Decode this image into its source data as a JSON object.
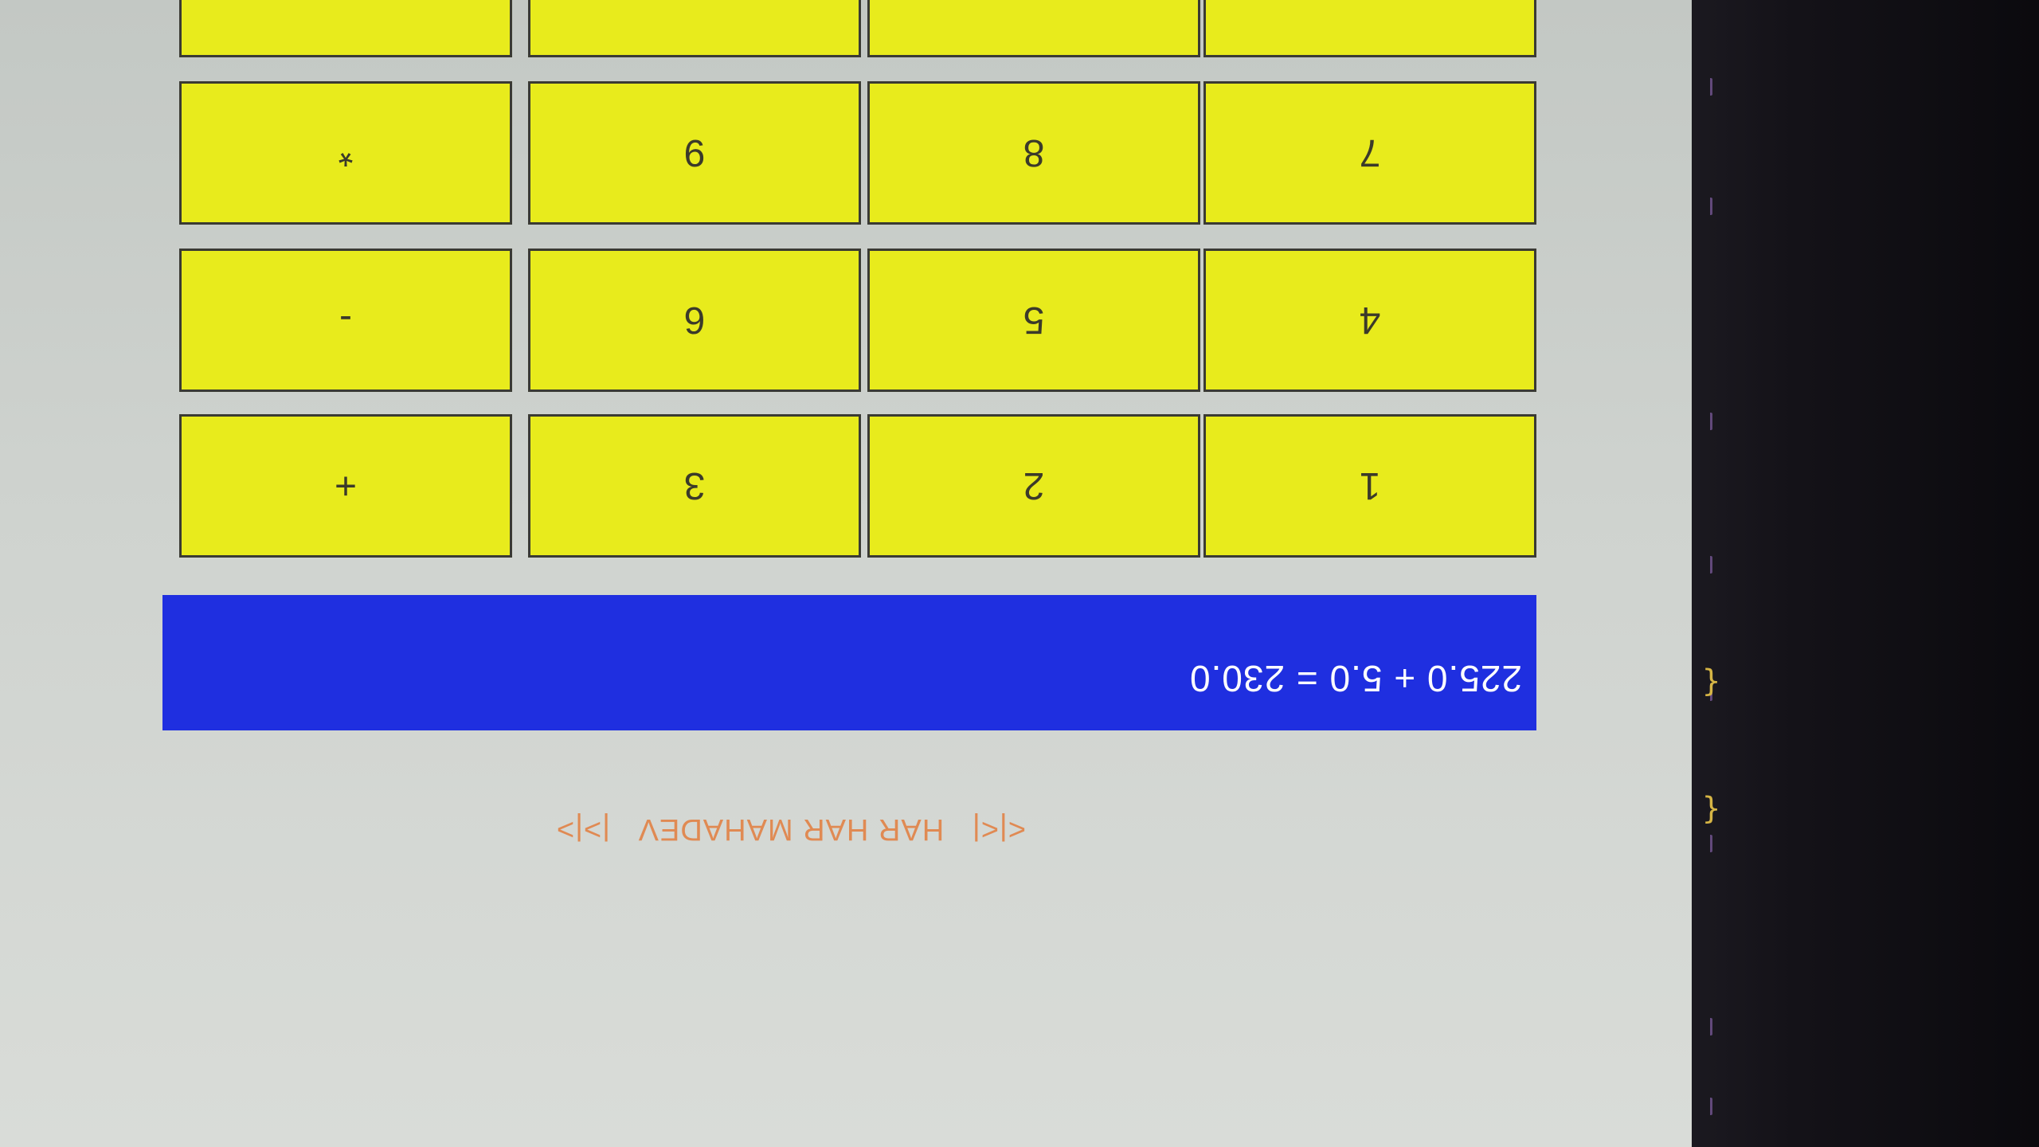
{
  "window": {
    "title": "<|<|   HAR HAR MAHADEV   |>|>"
  },
  "display": {
    "text": "225.0 + 5.0 = 230.0"
  },
  "keypad": {
    "rows": [
      [
        "1",
        "2",
        "3",
        "+"
      ],
      [
        "4",
        "5",
        "6",
        "-"
      ],
      [
        "7",
        "8",
        "9",
        "*"
      ],
      [
        "",
        "",
        "",
        ""
      ]
    ]
  },
  "colors": {
    "display_background": "#1f2fe0",
    "display_text": "#ffffff",
    "key_background": "#e8eb1c",
    "title_text": "#e08a53",
    "window_background": "#d4d8d4"
  }
}
